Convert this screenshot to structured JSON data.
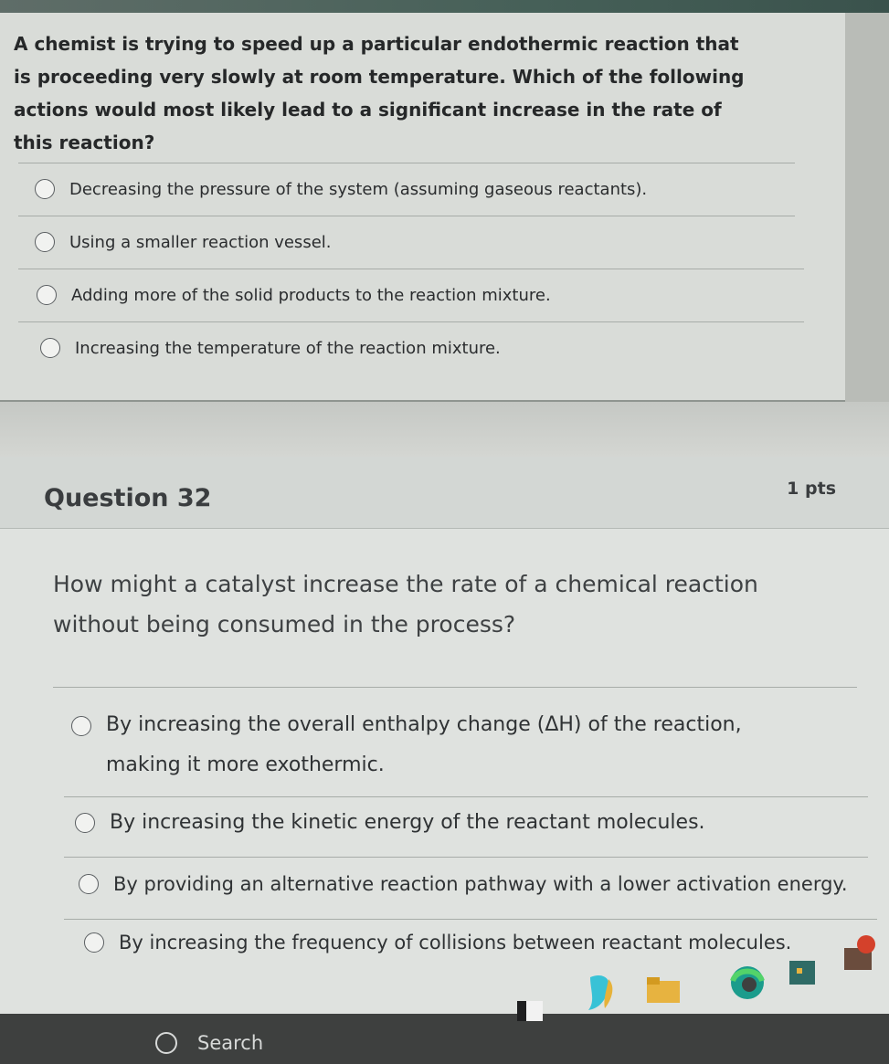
{
  "previous_question": {
    "text": "A chemist is trying to speed up a particular endothermic reaction that is proceeding very slowly at room temperature. Which of the following actions would most likely lead to a significant increase in the rate of this reaction?",
    "options": [
      "Decreasing the pressure of the system (assuming gaseous reactants).",
      "Using a smaller reaction vessel.",
      "Adding more of the solid products to the reaction mixture.",
      "Increasing the temperature of the reaction mixture."
    ]
  },
  "question": {
    "title": "Question 32",
    "points": "1 pts",
    "text": "How might a catalyst increase the rate of a chemical reaction without being consumed in the process?",
    "options": [
      "By increasing the overall enthalpy change (ΔH) of the reaction, making it more exothermic.",
      "By increasing the kinetic energy of the reactant molecules.",
      "By providing an alternative reaction pathway with a lower activation energy.",
      "By increasing the frequency of collisions between reactant molecules."
    ]
  },
  "taskbar": {
    "search_label": "Search",
    "icons": [
      "file-explorer-icon",
      "copilot-icon",
      "folder-icon",
      "edge-icon",
      "store-icon",
      "app-icon"
    ]
  }
}
